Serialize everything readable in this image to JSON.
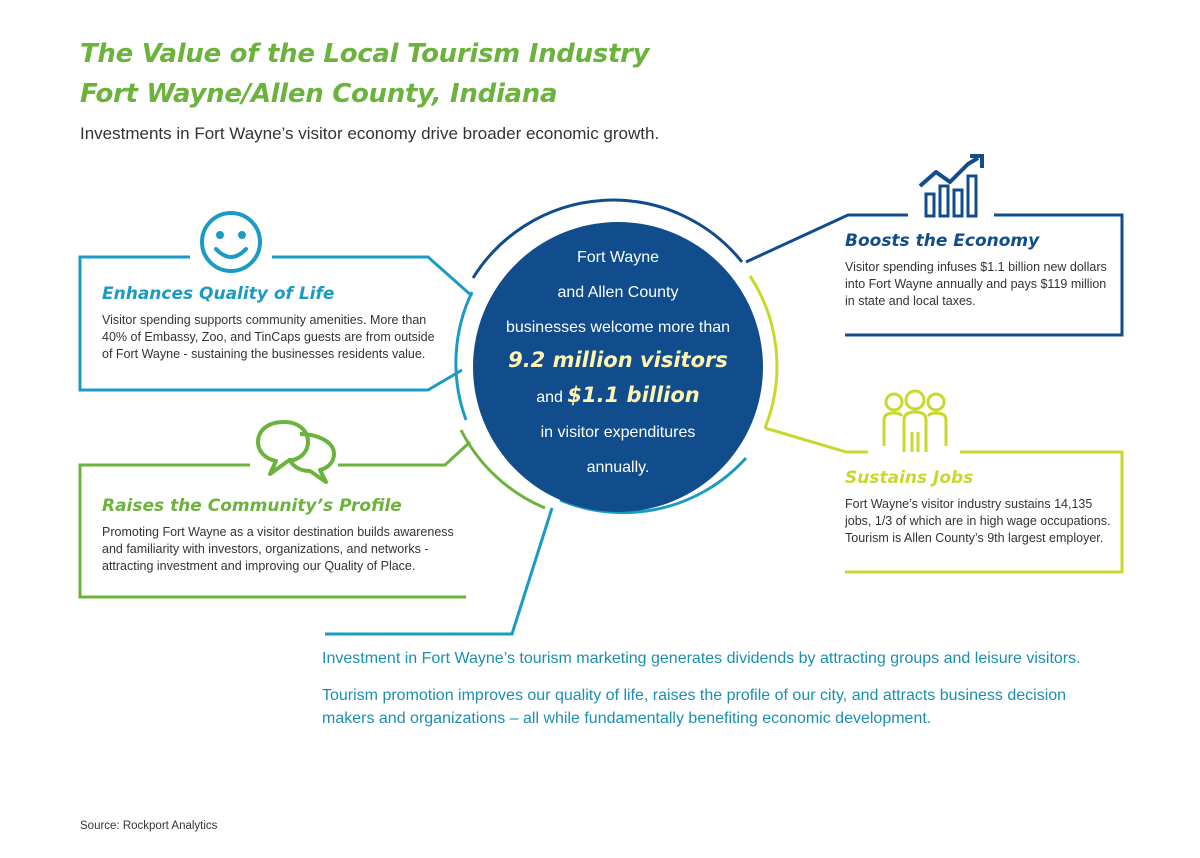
{
  "title": {
    "line1": "The Value of the Local Tourism Industry",
    "line2": "Fort Wayne/Allen County, Indiana"
  },
  "subtitle": "Investments in Fort Wayne’s visitor economy drive broader economic growth.",
  "center": {
    "line1": "Fort Wayne",
    "line2": "and Allen County",
    "line3": "businesses welcome more than",
    "visitors": "9.2 million visitors",
    "and": "and",
    "amount": "$1.1 billion",
    "line5": "in visitor expenditures",
    "line6": "annually."
  },
  "boxes": {
    "quality": {
      "title": "Enhances Quality of Life",
      "text": "Visitor spending supports community amenities. More than 40% of Embassy, Zoo, and TinCaps guests are from outside of Fort Wayne - sustaining the businesses residents value.",
      "icon": "smiley-icon",
      "color": "#1b9bc4"
    },
    "profile": {
      "title": "Raises the Community’s Profile",
      "text": "Promoting Fort Wayne as a visitor destination builds awareness and familiarity with investors, organizations, and networks - attracting investment and improving our Quality of Place.",
      "icon": "speech-bubbles-icon",
      "color": "#6cb33e"
    },
    "economy": {
      "title": "Boosts the Economy",
      "text": "Visitor spending infuses $1.1 billion new dollars into Fort Wayne annually and pays $119 million in state and local taxes.",
      "icon": "growth-chart-icon",
      "color": "#114c8d"
    },
    "jobs": {
      "title": "Sustains Jobs",
      "text": "Fort Wayne’s visitor industry sustains 14,135 jobs, 1/3 of which are in high wage occupations. Tourism is Allen County’s 9th largest employer.",
      "icon": "people-group-icon",
      "color": "#c8d92b"
    }
  },
  "bottom": {
    "p1": "Investment in Fort Wayne’s tourism marketing generates dividends by attracting groups and leisure visitors.",
    "p2": "Tourism promotion improves our quality of life, raises the profile of our city, and attracts business decision makers and organizations – all while fundamentally benefiting economic development."
  },
  "source": "Source: Rockport Analytics"
}
